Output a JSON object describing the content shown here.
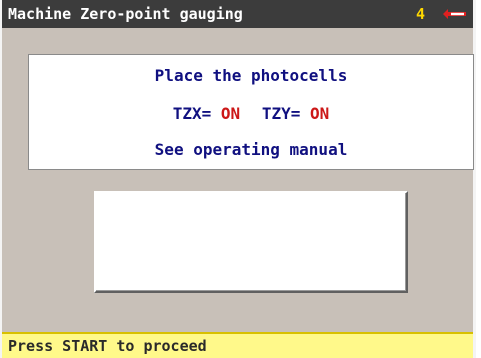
{
  "titlebar": {
    "title": "Machine Zero-point gauging",
    "number": "4",
    "logo_icon": "brand-logo-icon",
    "logo_color": "#e02020"
  },
  "message": {
    "line1": "Place the photocells",
    "tzx_label": "TZX=",
    "tzx_value": "ON",
    "tzy_label": "TZY=",
    "tzy_value": "ON",
    "line3": "See operating manual"
  },
  "status": {
    "text": "Press START to proceed"
  },
  "colors": {
    "titlebar_bg": "#3c3c3c",
    "screen_bg": "#c8c0b8",
    "message_text": "#101080",
    "value_red": "#cc1818",
    "status_bg": "#fff98a"
  }
}
